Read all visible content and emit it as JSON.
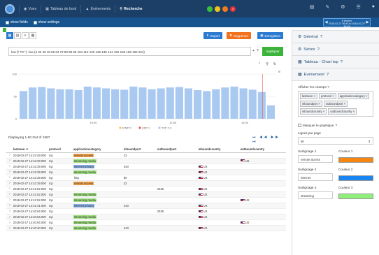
{
  "nav": {
    "items": [
      {
        "icon": "eye-icon",
        "label": "Vues"
      },
      {
        "icon": "dashboard-icon",
        "label": "Tableau de bord"
      },
      {
        "icon": "warning-icon",
        "label": "Événements"
      },
      {
        "icon": "search-icon",
        "label": "Recherche"
      }
    ],
    "badges": [
      {
        "text": "",
        "color": "#3cbf3c"
      },
      {
        "text": "",
        "color": "#f2c21b"
      },
      {
        "text": "",
        "color": "#f07b1e"
      },
      {
        "text": "4",
        "color": "#e0323b"
      }
    ]
  },
  "subbar": {
    "show_fields": "show fields",
    "show_settings": "show settings",
    "time_title": "8 heures",
    "time_range": "2018-02-27 06:43 to 2018-02-27 14:43"
  },
  "toolbar": {
    "export_label": "Export",
    "delete_label": "Supprimer",
    "save_label": "Enregistrer",
    "apply_label": "Appliquer"
  },
  "query": "low (l'  TO  ') -low (4 32 40 48 56 64 72 80 88 96 104 112 120 128 136 144 152 160 168 192 224)",
  "chart_data": {
    "type": "bar",
    "x_ticks": [
      "10:00",
      "12:00",
      "14:00"
    ],
    "ylim": [
      0,
      100
    ],
    "y_ticks": [
      0,
      50,
      100
    ],
    "legend": [
      "ICMP 0",
      "UDP 1",
      "TCP 2.3"
    ],
    "legend_colors": [
      "#f6c35a",
      "#e85b5b",
      "#a9c9f0"
    ],
    "values": [
      62,
      70,
      71,
      68,
      66,
      66,
      64,
      72,
      70,
      68,
      66,
      65,
      72,
      70,
      66,
      68,
      70,
      71,
      68,
      64,
      62,
      66,
      70,
      72,
      68,
      65,
      60,
      30
    ],
    "marker_index": 26,
    "bar_color": "#a9c9f0",
    "marker_color": "#e85b5b"
  },
  "results": {
    "displaying": "Displaying 1-50 Out of 1587",
    "pager": "⏮ ◀◀ ▶▶ ⏭"
  },
  "table": {
    "columns": [
      "lastseen ▼",
      "protocol",
      "applicationcategory",
      "inboundport",
      "outboundport",
      "inboundcountry",
      "outboundcountry"
    ],
    "rows": [
      {
        "t": "2018-02-27 14:43:49.000",
        "p": "tcp",
        "a": "remote access",
        "ah": "remote",
        "ip": "22",
        "op": "",
        "ic": "",
        "oc": ""
      },
      {
        "t": "2018-02-27 14:42:39.000",
        "p": "tcp",
        "a": "streaming media",
        "ah": "streaming",
        "ip": "",
        "op": "",
        "ic": "",
        "oc": "US"
      },
      {
        "t": "2018-02-27 14:42:39.000",
        "p": "tcp",
        "a": "internet privacy",
        "ah": "internet",
        "ip": "443",
        "op": "",
        "ic": "US",
        "oc": ""
      },
      {
        "t": "2018-02-27 14:42:39.000",
        "p": "tcp",
        "a": "streaming media",
        "ah": "streaming",
        "ip": "",
        "op": "",
        "ic": "US",
        "oc": ""
      },
      {
        "t": "2018-02-27 14:42:39.000",
        "p": "tcp",
        "a": "http",
        "ah": "",
        "ip": "80",
        "op": "",
        "ic": "US",
        "oc": ""
      },
      {
        "t": "2018-02-27 14:42:39.000",
        "p": "tcp",
        "a": "remote access",
        "ah": "remote",
        "ip": "22",
        "op": "",
        "ic": "",
        "oc": ""
      },
      {
        "t": "2018-02-27 14:41:52.000",
        "p": "tcp",
        "a": "",
        "ah": "",
        "ip": "",
        "op": "2525",
        "ic": "US",
        "oc": ""
      },
      {
        "t": "2018-02-27 14:41:52.000",
        "p": "tcp",
        "a": "streaming media",
        "ah": "streaming",
        "ip": "",
        "op": "",
        "ic": "US",
        "oc": ""
      },
      {
        "t": "2018-02-27 14:41:52.000",
        "p": "tcp",
        "a": "streaming media",
        "ah": "streaming",
        "ip": "",
        "op": "",
        "ic": "",
        "oc": "US"
      },
      {
        "t": "2018-02-27 14:41:41.000",
        "p": "tcp",
        "a": "internet privacy",
        "ah": "internet",
        "ip": "443",
        "op": "",
        "ic": "US",
        "oc": ""
      },
      {
        "t": "2018-02-27 14:40:54.000",
        "p": "tcp",
        "a": "",
        "ah": "",
        "ip": "",
        "op": "2525",
        "ic": "US",
        "oc": ""
      },
      {
        "t": "2018-02-27 14:40:54.000",
        "p": "tcp",
        "a": "streaming media",
        "ah": "streaming",
        "ip": "",
        "op": "",
        "ic": "US",
        "oc": ""
      },
      {
        "t": "2018-02-27 14:40:54.000",
        "p": "tcp",
        "a": "streaming media",
        "ah": "streaming",
        "ip": "",
        "op": "",
        "ic": "",
        "oc": "US"
      },
      {
        "t": "2018-02-27 14:40:40.000",
        "p": "tcp",
        "a": "streaming media",
        "ah": "streaming",
        "ip": "443",
        "op": "",
        "ic": "US",
        "oc": ""
      }
    ]
  },
  "sidebar": {
    "sections": [
      "Général",
      "Séries",
      "Tableau - Chart top",
      "Evénement"
    ],
    "fields_label": "Afficher les champs",
    "chips": [
      "lastseen",
      "protocol",
      "applicationcategory",
      "inboundport",
      "outboundport",
      "inboundcountry",
      "outboundcountry"
    ],
    "hide_chart": "Masquer le graphique",
    "rows_label": "Lignes par page",
    "rows_value": "50",
    "hl1_label": "Surlignage 1",
    "hl1_value": "remote access",
    "c1_label": "Couleur 1",
    "c1": "#f5860f",
    "hl2_label": "Surlignage 2",
    "hl2_value": "internet",
    "c2_label": "Couleur 2",
    "c2": "#1a84f0",
    "hl3_label": "Surlignage 3",
    "hl3_value": "streaming",
    "c3_label": "Couleur 3",
    "c3": "#8ef07a"
  }
}
